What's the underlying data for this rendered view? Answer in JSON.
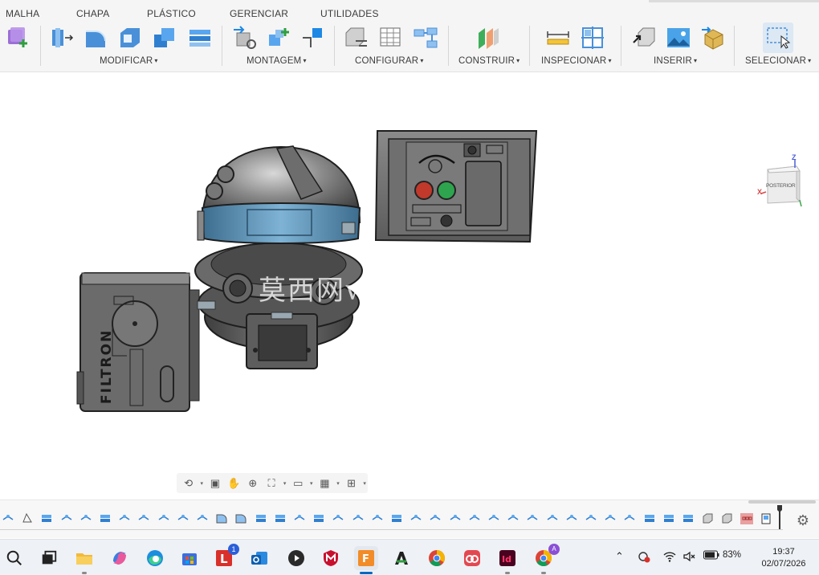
{
  "ribbon": {
    "tabs": [
      "MALHA",
      "CHAPA",
      "PLÁSTICO",
      "GERENCIAR",
      "UTILIDADES"
    ],
    "groups": [
      "MODIFICAR",
      "MONTAGEM",
      "CONFIGURAR",
      "CONSTRUIR",
      "INSPECIONAR",
      "INSERIR",
      "SELECIONAR"
    ],
    "caret": "▾"
  },
  "viewcube": {
    "face_label": "POSTERIOR",
    "axis_x": "X",
    "axis_z": "Z"
  },
  "model": {
    "battery_label": "FILTRON"
  },
  "watermark": "莫西网w",
  "navbar": {
    "icons": [
      "orbit-icon",
      "look-at-icon",
      "pan-icon",
      "zoom-icon",
      "fit-icon",
      "display-settings-icon",
      "grid-icon",
      "viewports-icon"
    ]
  },
  "taskbar": {
    "apps": [
      "search-icon",
      "task-view-icon",
      "file-explorer-icon",
      "copilot-icon",
      "edge-icon",
      "store-icon",
      "l-app-icon",
      "outlook-icon",
      "media-player-icon",
      "mcafee-icon",
      "fusion-icon",
      "a-app-icon",
      "chrome-icon",
      "creative-cloud-icon",
      "indesign-icon",
      "chrome-profile-icon"
    ],
    "badge_l_app": "1",
    "fusion_label": "F",
    "indesign_label": "Id",
    "profile_badge": "A",
    "battery_percent": "83%",
    "time": "19:37",
    "date": "02/07/2026"
  },
  "colors": {
    "ribbon_bg": "#f5f5f5",
    "accent_blue": "#1e88e5",
    "model_gray": "#6b6b6b",
    "visor_blue": "#5b8fb0",
    "button_red": "#c0392b",
    "button_green": "#2ea44f",
    "timeline_active": "#e8a0a0"
  }
}
